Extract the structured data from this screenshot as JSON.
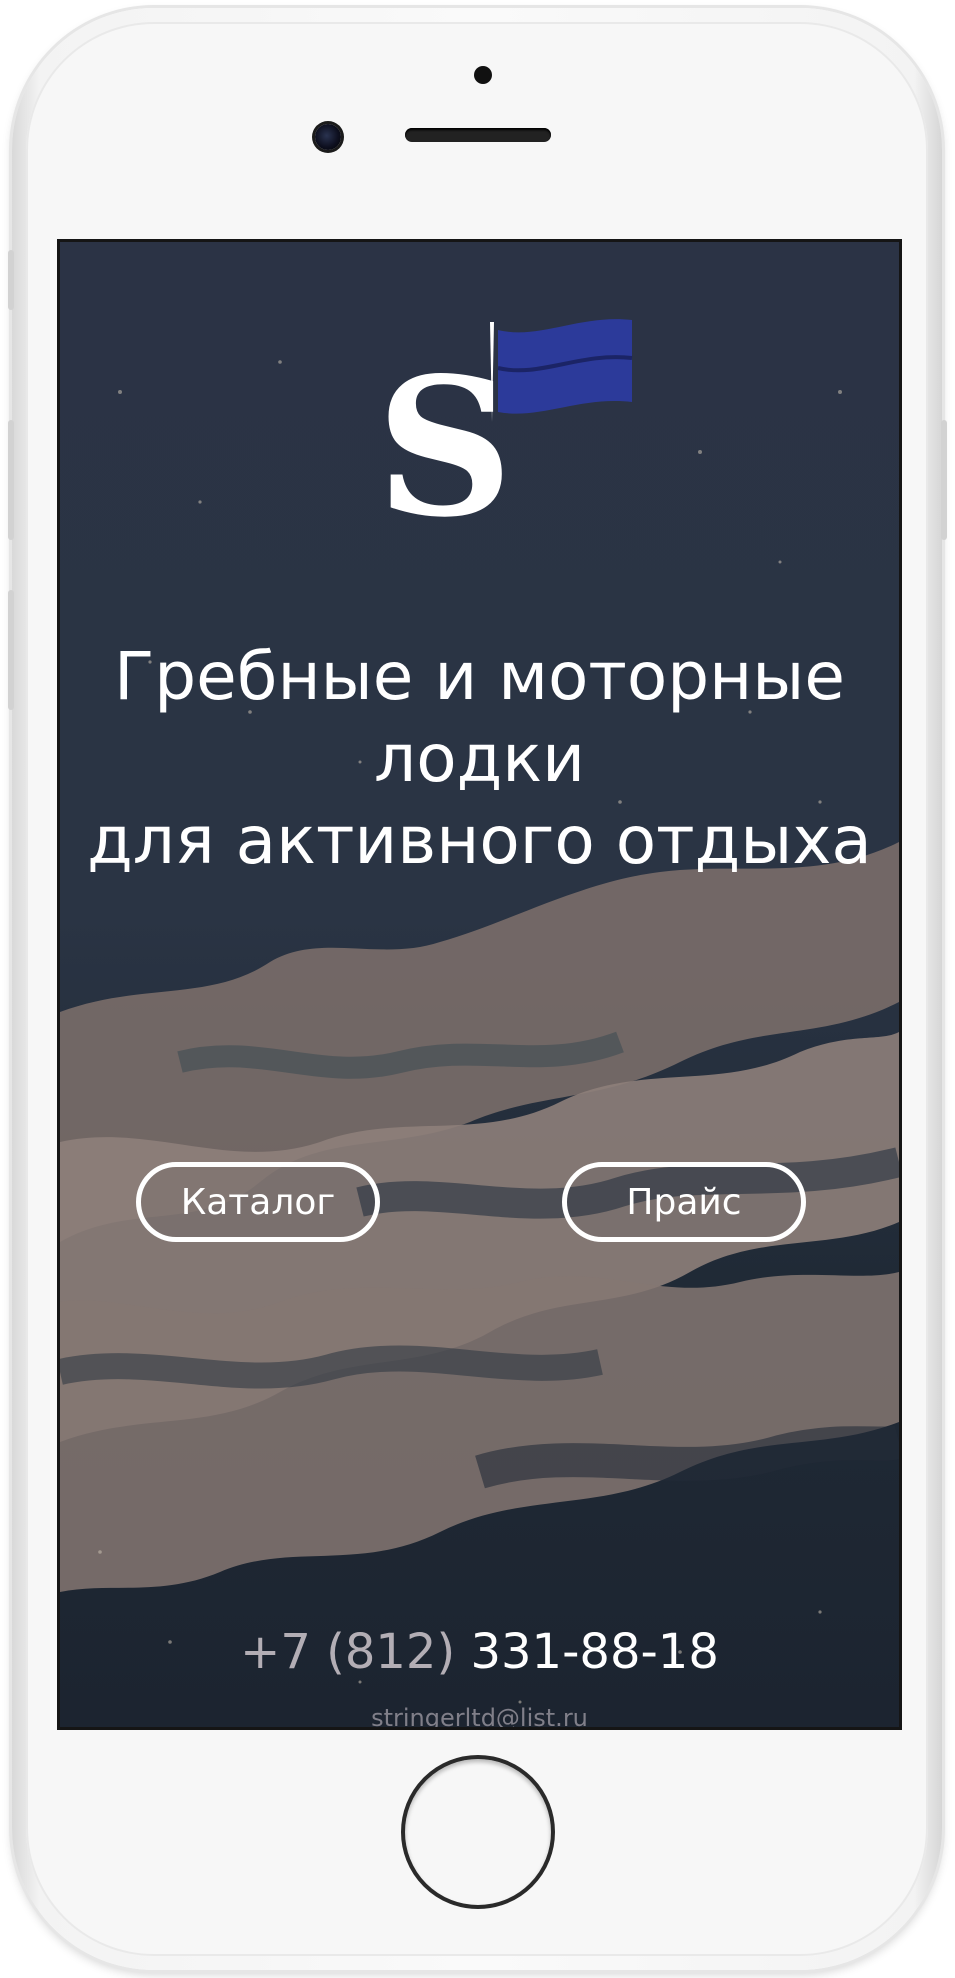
{
  "hero": {
    "headline_line1": "Гребные и моторные",
    "headline_line2": "лодки",
    "headline_line3": "для активного отдыха"
  },
  "buttons": {
    "catalog_label": "Каталог",
    "price_label": "Прайс"
  },
  "contacts": {
    "phone_prefix": "+7 (812)",
    "phone_main": "331-88-18",
    "email": "stringerltd@list.ru"
  },
  "logo": {
    "letter": "S",
    "flag_color": "#2c3a9a"
  },
  "colors": {
    "background_dark": "#262f40",
    "foam": "#8f8079",
    "text": "#ffffff"
  },
  "icons": {
    "logo": "stringer-flag-logo"
  }
}
